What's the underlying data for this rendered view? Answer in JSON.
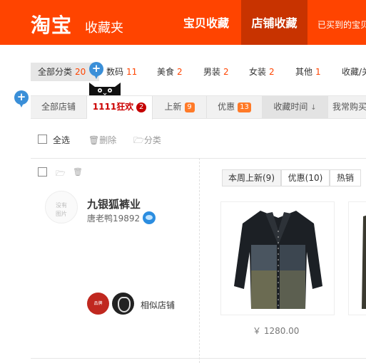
{
  "header": {
    "logo": "淘宝",
    "subtitle": "收藏夹",
    "nav_baobei": "宝贝收藏",
    "nav_shop": "店铺收藏",
    "nav_bought": "已买到的宝贝"
  },
  "categories": [
    {
      "label": "全部分类",
      "count": "20"
    },
    {
      "label": "数码",
      "count": "11"
    },
    {
      "label": "美食",
      "count": "2"
    },
    {
      "label": "男装",
      "count": "2"
    },
    {
      "label": "女装",
      "count": "2"
    },
    {
      "label": "其他",
      "count": "1"
    },
    {
      "label": "收藏/关",
      "count": ""
    }
  ],
  "tabs": [
    {
      "label": "全部店铺",
      "badge": ""
    },
    {
      "label": "1111狂欢",
      "badge": "2"
    },
    {
      "label": "上新",
      "badge": "9"
    },
    {
      "label": "优惠",
      "badge": "13"
    },
    {
      "label": "收藏时间",
      "icon": "arrow-down-icon"
    },
    {
      "label": "我常购买",
      "badge": ""
    }
  ],
  "actions": {
    "select_all": "全选",
    "delete": "删除",
    "classify": "分类"
  },
  "shop": {
    "avatar_placeholder_line1": "没有",
    "avatar_placeholder_line2": "图片",
    "name": "九银狐裤业",
    "owner": "唐老鸭19892",
    "similar_label": "相似店铺",
    "similar_ava1_text": "品牌"
  },
  "sub_tabs": [
    {
      "label": "本周上新(9)"
    },
    {
      "label": "优惠(10)"
    },
    {
      "label": "热销"
    }
  ],
  "product": {
    "price": "￥ 1280.00"
  },
  "colors": {
    "brand": "#ff4400",
    "active_tab": "#c83300",
    "accent_red": "#c40000"
  }
}
